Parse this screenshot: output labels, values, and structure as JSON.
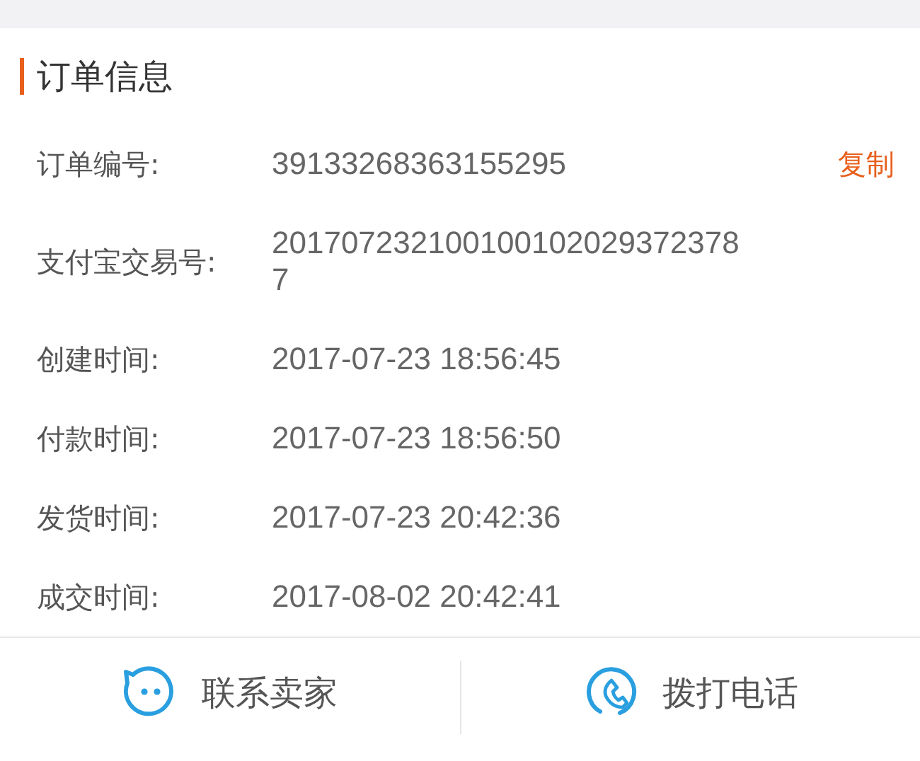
{
  "section": {
    "title": "订单信息"
  },
  "fields": [
    {
      "label": "订单编号:",
      "value": "39133268363155295",
      "action": "复制"
    },
    {
      "label": "支付宝交易号:",
      "value": "2017072321001001020293723787"
    },
    {
      "label": "创建时间:",
      "value": "2017-07-23 18:56:45"
    },
    {
      "label": "付款时间:",
      "value": "2017-07-23 18:56:50"
    },
    {
      "label": "发货时间:",
      "value": "2017-07-23 20:42:36"
    },
    {
      "label": "成交时间:",
      "value": "2017-08-02 20:42:41"
    }
  ],
  "bottom_bar": [
    {
      "kind": "chat",
      "label": "联系卖家"
    },
    {
      "kind": "phone",
      "label": "拨打电话"
    }
  ]
}
